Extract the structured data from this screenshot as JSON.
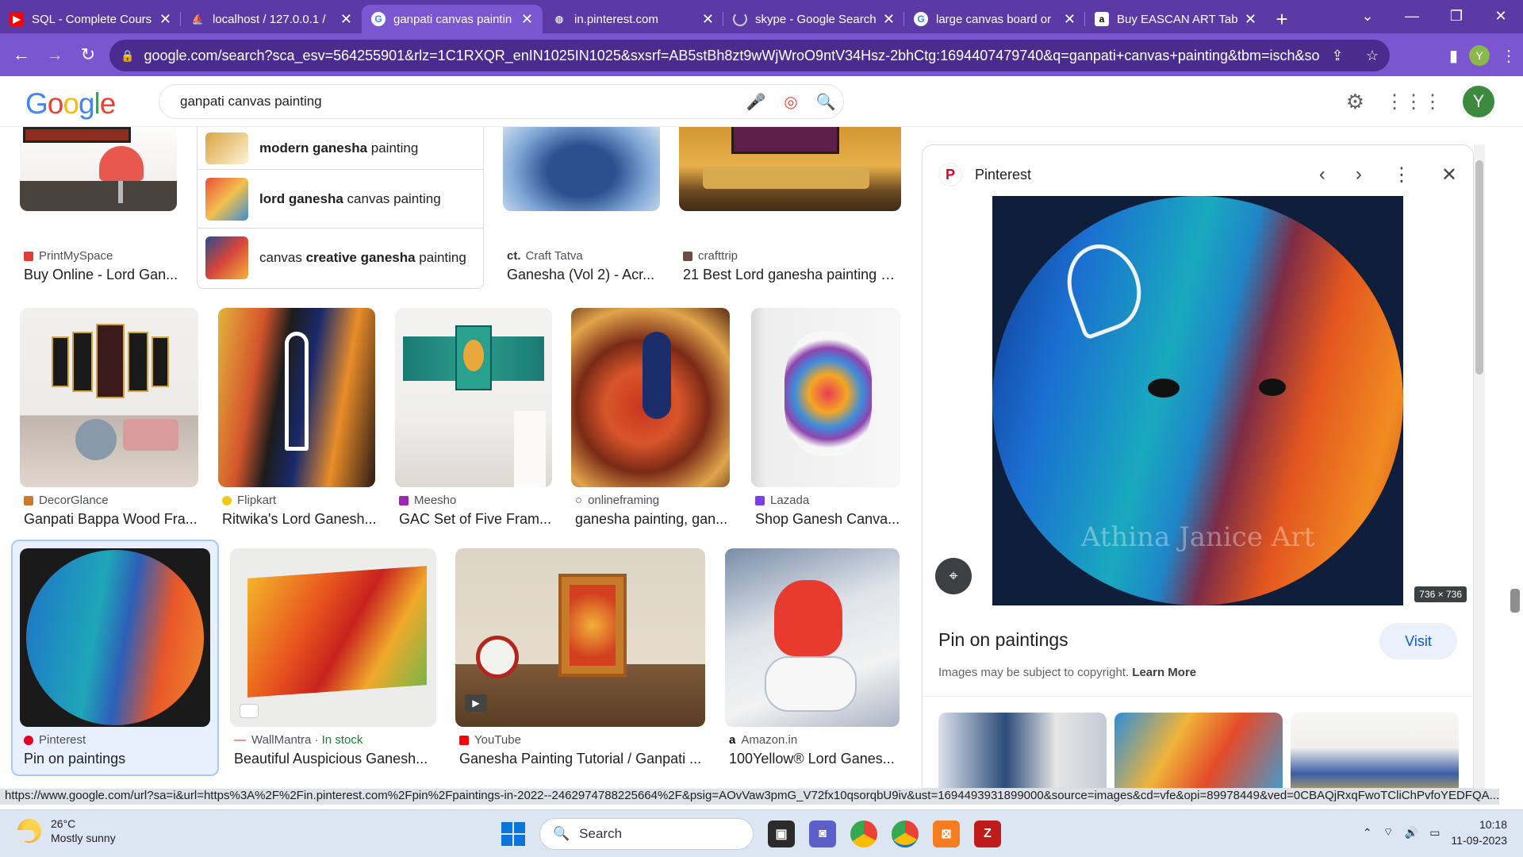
{
  "tabs": [
    {
      "title": "SQL - Complete Cours",
      "icon": "youtube-icon",
      "active": false
    },
    {
      "title": "localhost / 127.0.0.1 /",
      "icon": "phpmyadmin-icon",
      "active": false
    },
    {
      "title": "ganpati canvas paintin",
      "icon": "google-icon",
      "active": true
    },
    {
      "title": "in.pinterest.com",
      "icon": "globe-icon",
      "active": false
    },
    {
      "title": "skype - Google Search",
      "icon": "loading-icon",
      "active": false
    },
    {
      "title": "large canvas board or",
      "icon": "google-icon",
      "active": false
    },
    {
      "title": "Buy EASCAN ART Tab",
      "icon": "amazon-icon",
      "active": false
    }
  ],
  "address": {
    "url": "google.com/search?sca_esv=564255901&rlz=1C1RXQR_enIN1025IN1025&sxsrf=AB5stBh8zt9wWjWroO9ntV34Hsz-2bhCtg:1694407479740&q=ganpati+canvas+painting&tbm=isch&source=lnm..."
  },
  "profile_initial": "Y",
  "google": {
    "logo": "Google",
    "query": "ganpati canvas painting",
    "avatar": "Y"
  },
  "suggestions": [
    {
      "bold": "modern ganesha",
      "rest": " painting"
    },
    {
      "bold": "lord ganesha",
      "rest": " canvas painting"
    },
    {
      "pre": "canvas ",
      "bold": "creative ganesha",
      "rest": " painting"
    }
  ],
  "results_row1": [
    {
      "source": "PrintMySpace",
      "title": "Buy Online - Lord Gan..."
    },
    {
      "source": "Craft Tatva",
      "title": "Ganesha (Vol 2) - Acr..."
    },
    {
      "source": "crafttrip",
      "title": "21 Best Lord ganesha painting o..."
    }
  ],
  "results_row2": [
    {
      "source": "DecorGlance",
      "title": "Ganpati Bappa Wood Fra..."
    },
    {
      "source": "Flipkart",
      "title": "Ritwika's Lord Ganesh..."
    },
    {
      "source": "Meesho",
      "title": "GAC Set of Five Fram..."
    },
    {
      "source": "onlineframing",
      "title": "ganesha painting, gan..."
    },
    {
      "source": "Lazada",
      "title": "Shop Ganesh Canva..."
    }
  ],
  "results_row3": [
    {
      "source": "Pinterest",
      "title": "Pin on paintings"
    },
    {
      "source": "WallMantra",
      "stock": "In stock",
      "title": "Beautiful Auspicious Ganesh..."
    },
    {
      "source": "YouTube",
      "title": "Ganesha Painting Tutorial / Ganpati ..."
    },
    {
      "source": "Amazon.in",
      "title": "100Yellow® Lord Ganes..."
    }
  ],
  "panel": {
    "source": "Pinterest",
    "dimensions": "736 × 736",
    "watermark": "Athina Janice Art",
    "title": "Pin on paintings",
    "visit": "Visit",
    "copyright": "Images may be subject to copyright.",
    "learn_more": "Learn More"
  },
  "status_url": "https://www.google.com/url?sa=i&url=https%3A%2F%2Fin.pinterest.com%2Fpin%2Fpaintings-in-2022--246297478822566​4%2F&psig=AOvVaw3pmG_V72fx10qsorqbU9iv&ust=1694493931899000&source=images&cd=vfe&opi=89978449&ved=0CBAQjRxqFwoTCliChPvfoYEDFQA...",
  "taskbar": {
    "temp": "26°C",
    "weather": "Mostly sunny",
    "search": "Search",
    "time": "10:18",
    "date": "11-09-2023"
  },
  "colors": {
    "chrome_purple": "#5b3aa6",
    "accent_blue": "#0b57d0",
    "pinterest_red": "#e60023"
  }
}
